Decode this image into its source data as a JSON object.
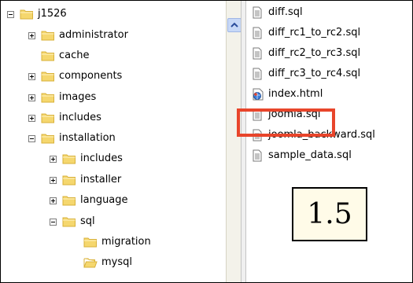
{
  "tree": {
    "items": [
      {
        "label": "j1526",
        "expander": "minus",
        "icon": "folder-icon"
      },
      {
        "label": "administrator",
        "expander": "plus",
        "icon": "folder-icon"
      },
      {
        "label": "cache",
        "expander": "none",
        "icon": "folder-icon"
      },
      {
        "label": "components",
        "expander": "plus",
        "icon": "folder-icon"
      },
      {
        "label": "images",
        "expander": "plus",
        "icon": "folder-icon"
      },
      {
        "label": "includes",
        "expander": "plus",
        "icon": "folder-icon"
      },
      {
        "label": "installation",
        "expander": "minus",
        "icon": "folder-icon"
      },
      {
        "label": "includes",
        "expander": "plus",
        "icon": "folder-icon"
      },
      {
        "label": "installer",
        "expander": "plus",
        "icon": "folder-icon"
      },
      {
        "label": "language",
        "expander": "plus",
        "icon": "folder-icon"
      },
      {
        "label": "sql",
        "expander": "minus",
        "icon": "folder-icon"
      },
      {
        "label": "migration",
        "expander": "none",
        "icon": "folder-icon"
      },
      {
        "label": "mysql",
        "expander": "none",
        "icon": "folder-open-icon",
        "selected": true
      }
    ]
  },
  "files": {
    "items": [
      {
        "label": "diff.sql",
        "icon": "text-file-icon"
      },
      {
        "label": "diff_rc1_to_rc2.sql",
        "icon": "text-file-icon"
      },
      {
        "label": "diff_rc2_to_rc3.sql",
        "icon": "text-file-icon"
      },
      {
        "label": "diff_rc3_to_rc4.sql",
        "icon": "text-file-icon"
      },
      {
        "label": "index.html",
        "icon": "html-file-icon"
      },
      {
        "label": "joomla.sql",
        "icon": "text-file-icon",
        "highlighted": true
      },
      {
        "label": "joomla_backward.sql",
        "icon": "text-file-icon"
      },
      {
        "label": "sample_data.sql",
        "icon": "text-file-icon"
      }
    ]
  },
  "annotation": {
    "version": "1.5"
  },
  "colors": {
    "highlight": "#e8452b",
    "folder": "#f5d76e",
    "folder_dark": "#d8b13a"
  }
}
